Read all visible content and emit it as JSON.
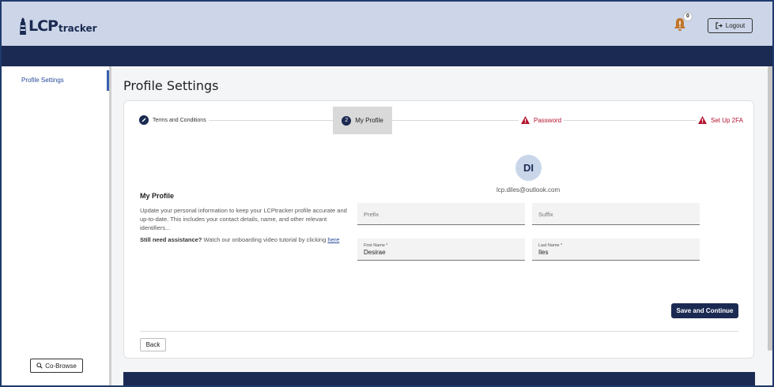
{
  "header": {
    "logo_lcp": "LCP",
    "logo_tracker": "tracker",
    "notifications_count": "0",
    "logout_label": "Logout"
  },
  "sidebar": {
    "items": [
      {
        "label": "Profile Settings"
      }
    ],
    "cobrowse_label": "Co-Browse"
  },
  "page_title": "Profile Settings",
  "stepper": {
    "steps": [
      {
        "label": "Terms and Conditions",
        "state": "complete"
      },
      {
        "number": "2",
        "label": "My Profile",
        "state": "active"
      },
      {
        "label": "Password",
        "state": "warning"
      },
      {
        "label": "Set Up 2FA",
        "state": "warning"
      }
    ]
  },
  "profile": {
    "initials": "DI",
    "email": "lcp.diles@outlook.com",
    "section_title": "My Profile",
    "description": "Update your personal information to keep your LCPtracker profile accurate and up-to-date. This includes your contact details, name, and other relevant identifiers...",
    "assist_bold": "Still need assistance?",
    "assist_text": " Watch our onboarding video tutorial by clicking ",
    "assist_link": "here"
  },
  "form": {
    "prefix_placeholder": "Prefix",
    "suffix_placeholder": "Suffix",
    "first_name_label": "First Name *",
    "first_name_value": "Desirae",
    "last_name_label": "Last Name *",
    "last_name_value": "Iles"
  },
  "actions": {
    "save_label": "Save and Continue",
    "back_label": "Back"
  },
  "colors": {
    "brand_navy": "#1b2a52",
    "header_bg": "#ccd6e8",
    "warning_red": "#b3122e",
    "link_blue": "#2a4d9c"
  }
}
